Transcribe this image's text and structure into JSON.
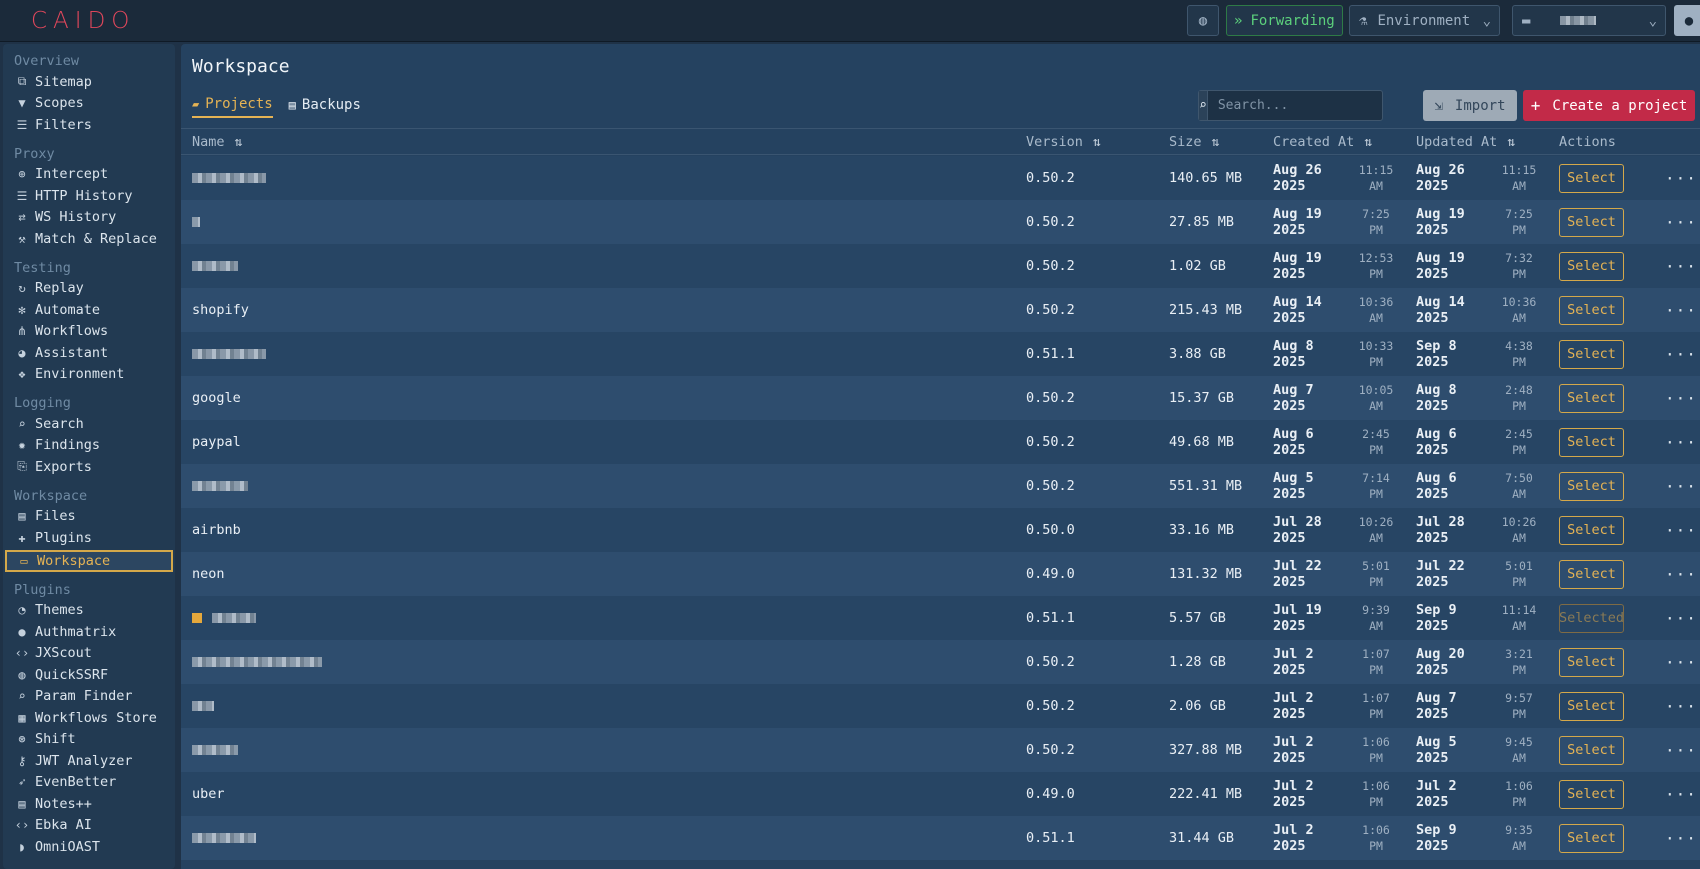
{
  "app": {
    "logo": "CAIDO",
    "forwarding_label": "Forwarding",
    "environment_label": "Environment"
  },
  "sidebar": {
    "sections": [
      {
        "title": "Overview",
        "items": [
          {
            "label": "Sitemap",
            "icon": "sitemap-icon"
          },
          {
            "label": "Scopes",
            "icon": "filter-icon"
          },
          {
            "label": "Filters",
            "icon": "sliders-icon"
          }
        ]
      },
      {
        "title": "Proxy",
        "items": [
          {
            "label": "Intercept",
            "icon": "crosshair-icon"
          },
          {
            "label": "HTTP History",
            "icon": "list-icon"
          },
          {
            "label": "WS History",
            "icon": "arrows-icon"
          },
          {
            "label": "Match & Replace",
            "icon": "wrench-icon"
          }
        ]
      },
      {
        "title": "Testing",
        "items": [
          {
            "label": "Replay",
            "icon": "refresh-icon"
          },
          {
            "label": "Automate",
            "icon": "chip-icon"
          },
          {
            "label": "Workflows",
            "icon": "flow-icon"
          },
          {
            "label": "Assistant",
            "icon": "chat-icon"
          },
          {
            "label": "Environment",
            "icon": "cubes-icon"
          }
        ]
      },
      {
        "title": "Logging",
        "items": [
          {
            "label": "Search",
            "icon": "search-icon"
          },
          {
            "label": "Findings",
            "icon": "bug-icon"
          },
          {
            "label": "Exports",
            "icon": "export-icon"
          }
        ]
      },
      {
        "title": "Workspace",
        "items": [
          {
            "label": "Files",
            "icon": "file-icon"
          },
          {
            "label": "Plugins",
            "icon": "puzzle-icon"
          },
          {
            "label": "Workspace",
            "icon": "monitor-icon",
            "active": true
          }
        ]
      },
      {
        "title": "Plugins",
        "items": [
          {
            "label": "Themes",
            "icon": "palette-icon"
          },
          {
            "label": "Authmatrix",
            "icon": "user-lock-icon"
          },
          {
            "label": "JXScout",
            "icon": "code-icon"
          },
          {
            "label": "QuickSSRF",
            "icon": "globe-icon"
          },
          {
            "label": "Param Finder",
            "icon": "search-icon"
          },
          {
            "label": "Workflows Store",
            "icon": "store-icon"
          },
          {
            "label": "Shift",
            "icon": "arrow-circle-icon"
          },
          {
            "label": "JWT Analyzer",
            "icon": "key-icon"
          },
          {
            "label": "EvenBetter",
            "icon": "rocket-icon"
          },
          {
            "label": "Notes++",
            "icon": "note-icon"
          },
          {
            "label": "Ebka AI",
            "icon": "code-icon"
          },
          {
            "label": "OmniOAST",
            "icon": "signal-icon"
          }
        ]
      }
    ]
  },
  "main": {
    "title": "Workspace",
    "tabs": [
      {
        "label": "Projects",
        "active": true
      },
      {
        "label": "Backups",
        "active": false
      }
    ],
    "search_placeholder": "Search...",
    "import_label": "Import",
    "create_label": "Create a project",
    "columns": {
      "name": "Name",
      "version": "Version",
      "size": "Size",
      "created": "Created At",
      "updated": "Updated At",
      "actions": "Actions"
    },
    "rows": [
      {
        "name": "",
        "version": "0.50.2",
        "size": "140.65 MB",
        "created_date": [
          "Aug 26",
          "2025"
        ],
        "created_time": [
          "11:15",
          "AM"
        ],
        "updated_date": [
          "Aug 26",
          "2025"
        ],
        "updated_time": [
          "11:15",
          "AM"
        ],
        "action": "Select"
      },
      {
        "name": "",
        "version": "0.50.2",
        "size": "27.85 MB",
        "created_date": [
          "Aug 19",
          "2025"
        ],
        "created_time": [
          "7:25",
          "PM"
        ],
        "updated_date": [
          "Aug 19",
          "2025"
        ],
        "updated_time": [
          "7:25",
          "PM"
        ],
        "action": "Select"
      },
      {
        "name": "",
        "version": "0.50.2",
        "size": "1.02 GB",
        "created_date": [
          "Aug 19",
          "2025"
        ],
        "created_time": [
          "12:53",
          "PM"
        ],
        "updated_date": [
          "Aug 19",
          "2025"
        ],
        "updated_time": [
          "7:32",
          "PM"
        ],
        "action": "Select"
      },
      {
        "name": "shopify",
        "version": "0.50.2",
        "size": "215.43 MB",
        "created_date": [
          "Aug 14",
          "2025"
        ],
        "created_time": [
          "10:36",
          "AM"
        ],
        "updated_date": [
          "Aug 14",
          "2025"
        ],
        "updated_time": [
          "10:36",
          "AM"
        ],
        "action": "Select"
      },
      {
        "name": "",
        "version": "0.51.1",
        "size": "3.88 GB",
        "created_date": [
          "Aug 8",
          "2025"
        ],
        "created_time": [
          "10:33",
          "PM"
        ],
        "updated_date": [
          "Sep 8",
          "2025"
        ],
        "updated_time": [
          "4:38",
          "PM"
        ],
        "action": "Select"
      },
      {
        "name": "google",
        "version": "0.50.2",
        "size": "15.37 GB",
        "created_date": [
          "Aug 7",
          "2025"
        ],
        "created_time": [
          "10:05",
          "AM"
        ],
        "updated_date": [
          "Aug 8",
          "2025"
        ],
        "updated_time": [
          "2:48",
          "PM"
        ],
        "action": "Select"
      },
      {
        "name": "paypal",
        "version": "0.50.2",
        "size": "49.68 MB",
        "created_date": [
          "Aug 6",
          "2025"
        ],
        "created_time": [
          "2:45",
          "PM"
        ],
        "updated_date": [
          "Aug 6",
          "2025"
        ],
        "updated_time": [
          "2:45",
          "PM"
        ],
        "action": "Select"
      },
      {
        "name": "",
        "version": "0.50.2",
        "size": "551.31 MB",
        "created_date": [
          "Aug 5",
          "2025"
        ],
        "created_time": [
          "7:14",
          "PM"
        ],
        "updated_date": [
          "Aug 6",
          "2025"
        ],
        "updated_time": [
          "7:50",
          "AM"
        ],
        "action": "Select"
      },
      {
        "name": "airbnb",
        "version": "0.50.0",
        "size": "33.16 MB",
        "created_date": [
          "Jul 28",
          "2025"
        ],
        "created_time": [
          "10:26",
          "AM"
        ],
        "updated_date": [
          "Jul 28",
          "2025"
        ],
        "updated_time": [
          "10:26",
          "AM"
        ],
        "action": "Select"
      },
      {
        "name": "neon",
        "version": "0.49.0",
        "size": "131.32 MB",
        "created_date": [
          "Jul 22",
          "2025"
        ],
        "created_time": [
          "5:01",
          "PM"
        ],
        "updated_date": [
          "Jul 22",
          "2025"
        ],
        "updated_time": [
          "5:01",
          "PM"
        ],
        "action": "Select"
      },
      {
        "name": "",
        "current": true,
        "version": "0.51.1",
        "size": "5.57 GB",
        "created_date": [
          "Jul 19",
          "2025"
        ],
        "created_time": [
          "9:39",
          "AM"
        ],
        "updated_date": [
          "Sep 9",
          "2025"
        ],
        "updated_time": [
          "11:14",
          "AM"
        ],
        "action": "Selected"
      },
      {
        "name": "",
        "version": "0.50.2",
        "size": "1.28 GB",
        "created_date": [
          "Jul 2",
          "2025"
        ],
        "created_time": [
          "1:07",
          "PM"
        ],
        "updated_date": [
          "Aug 20",
          "2025"
        ],
        "updated_time": [
          "3:21",
          "PM"
        ],
        "action": "Select"
      },
      {
        "name": "",
        "version": "0.50.2",
        "size": "2.06 GB",
        "created_date": [
          "Jul 2",
          "2025"
        ],
        "created_time": [
          "1:07",
          "PM"
        ],
        "updated_date": [
          "Aug 7",
          "2025"
        ],
        "updated_time": [
          "9:57",
          "PM"
        ],
        "action": "Select"
      },
      {
        "name": "",
        "version": "0.50.2",
        "size": "327.88 MB",
        "created_date": [
          "Jul 2",
          "2025"
        ],
        "created_time": [
          "1:06",
          "PM"
        ],
        "updated_date": [
          "Aug 5",
          "2025"
        ],
        "updated_time": [
          "9:45",
          "AM"
        ],
        "action": "Select"
      },
      {
        "name": "uber",
        "version": "0.49.0",
        "size": "222.41 MB",
        "created_date": [
          "Jul 2",
          "2025"
        ],
        "created_time": [
          "1:06",
          "PM"
        ],
        "updated_date": [
          "Jul 2",
          "2025"
        ],
        "updated_time": [
          "1:06",
          "PM"
        ],
        "action": "Select"
      },
      {
        "name": "",
        "version": "0.51.1",
        "size": "31.44 GB",
        "created_date": [
          "Jul 2",
          "2025"
        ],
        "created_time": [
          "1:06",
          "PM"
        ],
        "updated_date": [
          "Sep 9",
          "2025"
        ],
        "updated_time": [
          "9:35",
          "AM"
        ],
        "action": "Select"
      }
    ]
  }
}
